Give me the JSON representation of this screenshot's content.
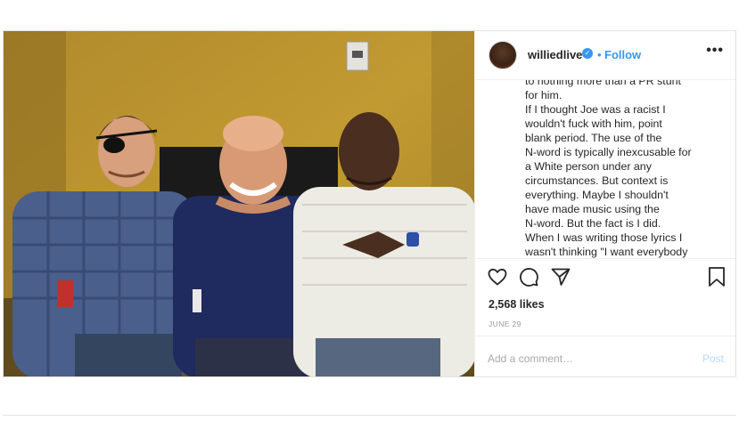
{
  "post": {
    "username": "williedlive",
    "verified_glyph": "✓",
    "separator": "•",
    "follow_label": "Follow",
    "more_glyph": "•••",
    "caption_lines": [
      "to nothing more than a PR stunt",
      "for him.",
      "If I thought Joe was a racist I",
      "wouldn't fuck with him, point",
      "blank period. The use of the",
      "N-word is typically inexcusable for",
      "a White person under any",
      "circumstances. But context is",
      "everything. Maybe I shouldn't",
      "have made music using the",
      "N-word. But the fact is I did.",
      "When I was writing those lyrics I",
      "wasn't thinking \"I want everybody"
    ],
    "likes": "2,568 likes",
    "date": "JUNE 29",
    "comment_placeholder": "Add a comment…",
    "post_label": "Post"
  },
  "icons": {
    "like": "heart-icon",
    "comment": "comment-icon",
    "share": "share-icon",
    "save": "bookmark-icon",
    "verified": "verified-badge-icon",
    "more": "more-options-icon"
  },
  "colors": {
    "accent": "#3897f0",
    "text": "#262626",
    "muted": "#999999",
    "post_disabled": "#b3dbff"
  }
}
